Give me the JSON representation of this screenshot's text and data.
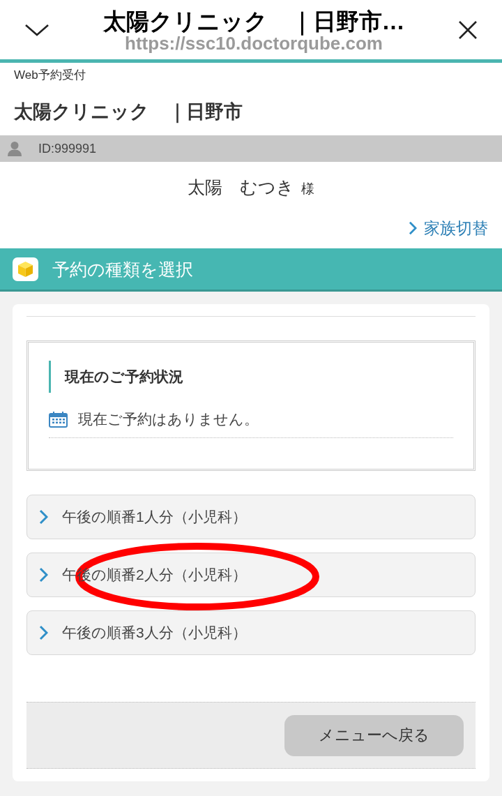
{
  "browser_bar": {
    "title": "太陽クリニック　｜日野市…",
    "url": "https://ssc10.doctorqube.com"
  },
  "header": {
    "caption": "Web予約受付",
    "clinic": "太陽クリニック　｜日野市"
  },
  "user_bar": {
    "id": "ID:999991"
  },
  "patient": {
    "name": "太陽　むつき",
    "honorific": "様"
  },
  "family_switch": {
    "label": "家族切替"
  },
  "section": {
    "title": "予約の種類を選択"
  },
  "status_box": {
    "heading": "現在のご予約状況",
    "message": "現在ご予約はありません。"
  },
  "reservation_types": [
    {
      "label": "午後の順番1人分（小児科）",
      "circled": false
    },
    {
      "label": "午後の順番2人分（小児科）",
      "circled": true
    },
    {
      "label": "午後の順番3人分（小児科）",
      "circled": false
    }
  ],
  "footer": {
    "back_button": "メニューへ戻る"
  }
}
